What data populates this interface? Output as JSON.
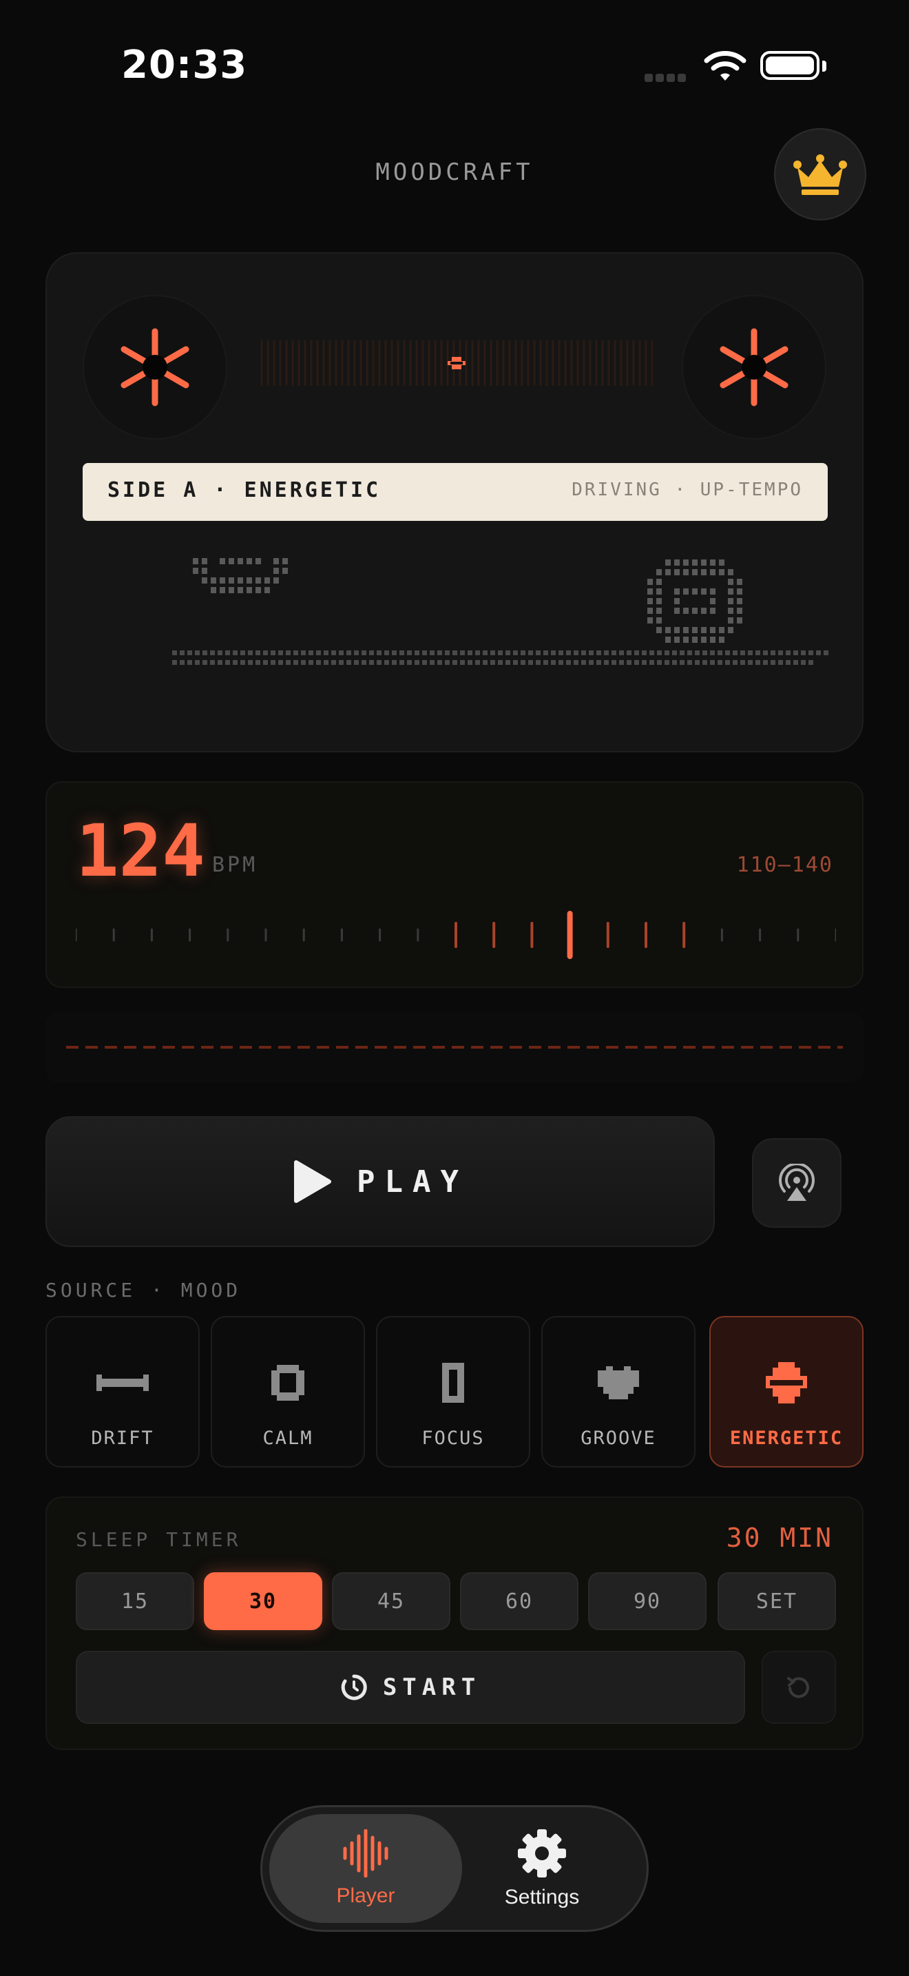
{
  "status": {
    "time": "20:33"
  },
  "header": {
    "title": "MOODCRAFT",
    "premium_icon": "crown-icon"
  },
  "cassette": {
    "side_label": "SIDE A · ENERGETIC",
    "descriptor": "DRIVING · UP-TEMPO"
  },
  "bpm": {
    "value": "124",
    "unit": "BPM",
    "range": "110–140"
  },
  "player": {
    "play_label": "PLAY",
    "airplay_icon": "airplay-icon"
  },
  "moods": {
    "section_label": "SOURCE · MOOD",
    "items": [
      {
        "label": "DRIFT",
        "icon": "drift-icon",
        "selected": false
      },
      {
        "label": "CALM",
        "icon": "calm-icon",
        "selected": false
      },
      {
        "label": "FOCUS",
        "icon": "focus-icon",
        "selected": false
      },
      {
        "label": "GROOVE",
        "icon": "groove-icon",
        "selected": false
      },
      {
        "label": "ENERGETIC",
        "icon": "energetic-icon",
        "selected": true
      }
    ]
  },
  "sleep_timer": {
    "title": "SLEEP TIMER",
    "value": "30 MIN",
    "options": [
      "15",
      "30",
      "45",
      "60",
      "90",
      "SET"
    ],
    "selected": "30",
    "start_label": "START"
  },
  "tabs": [
    {
      "label": "Player",
      "icon": "waveform-icon",
      "active": true
    },
    {
      "label": "Settings",
      "icon": "gear-icon",
      "active": false
    }
  ],
  "colors": {
    "accent": "#ff6b47",
    "background": "#0a0a0a",
    "label_paper": "#f0e9dc",
    "premium": "#f5b52e"
  }
}
